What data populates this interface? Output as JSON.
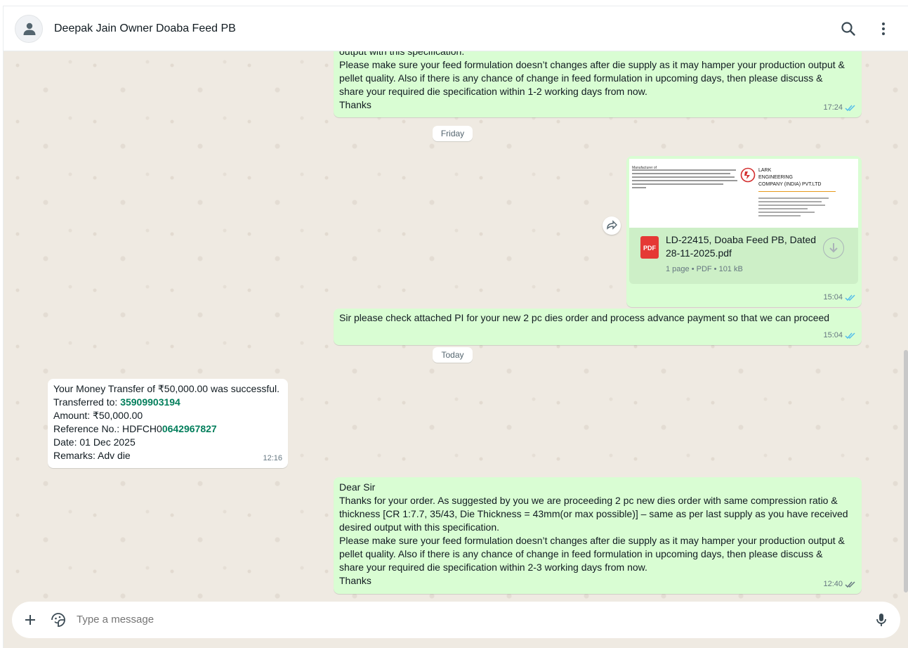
{
  "header": {
    "contact_name": "Deepak Jain Owner Doaba Feed PB",
    "icons": [
      "default-avatar-icon",
      "search-icon",
      "menu-dots-icon"
    ]
  },
  "messages": {
    "m1": {
      "lines": [
        "output with this specification.",
        "Please make sure your feed formulation doesn’t changes after die supply as it may hamper your production output &",
        "pellet quality. Also if there is any chance of change in feed formulation in upcoming days, then please discuss &",
        "share your required die specification within 1-2 working days from now.",
        "Thanks"
      ],
      "time": "17:24"
    },
    "day_friday": "Friday",
    "m2": {
      "thumb": {
        "manufacturer": "Manufacturer of",
        "company_line1": "LARK",
        "company_line2": "ENGINEERING",
        "company_line3": "COMPANY (INDIA) PVT.LTD"
      },
      "file_line1": "LD-22415, Doaba Feed PB, Dated",
      "file_line2": "28-11-2025.pdf",
      "file_badge": "PDF",
      "file_info": "1 page • PDF • 101 kB",
      "time": "15:04"
    },
    "m3": {
      "text": "Sir please check attached PI for your new 2 pc dies order and process advance payment so that we can proceed",
      "time": "15:04"
    },
    "day_today": "Today",
    "m4": {
      "line1": "Your Money Transfer of ₹50,000.00 was successful.",
      "line2_label": "Transferred to: ",
      "line2_value": "35909903194",
      "line3": "Amount: ₹50,000.00",
      "line4_label": "Reference No.: HDFCH0",
      "line4_value": "0642967827",
      "line5": "Date: 01 Dec 2025",
      "line6": "Remarks: Adv die",
      "time": "12:16"
    },
    "m5": {
      "lines": [
        "Dear Sir",
        "Thanks for your order. As suggested by you we are proceeding 2 pc new dies order with same compression ratio &",
        "thickness [CR 1:7.7, 35/43, Die Thickness = 43mm(or max possible)] – same as per last supply as you have received",
        "desired output with this specification.",
        "Please make sure your feed formulation doesn’t changes after die supply as it may hamper your production output &",
        "pellet quality. Also if there is any chance of change in feed formulation in upcoming days, then please discuss &",
        "share your required die specification within 2-3 working days from now.",
        "Thanks"
      ],
      "time": "12:40"
    }
  },
  "composer": {
    "placeholder": "Type a message",
    "icons": [
      "plus-icon",
      "sticker-icon",
      "microphone-icon"
    ]
  },
  "colors": {
    "outgoing_bubble": "#d9fdd3",
    "incoming_bubble": "#ffffff",
    "chat_background": "#efeae2",
    "read_tick": "#53bdeb",
    "link_green": "#027e5b"
  }
}
